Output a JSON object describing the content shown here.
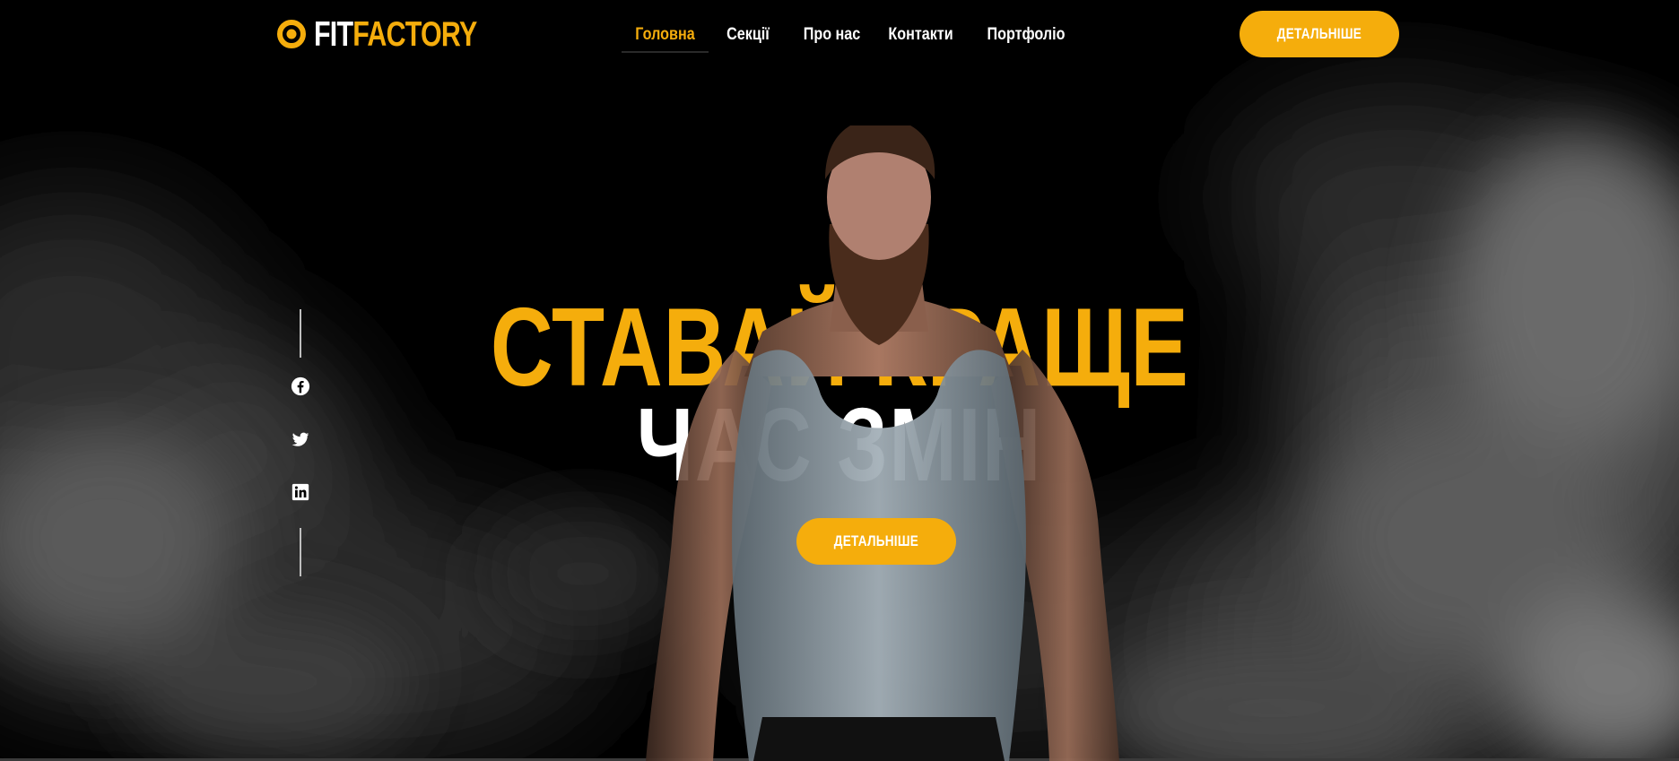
{
  "brand": {
    "name_part1": "FIT",
    "name_part2": "FACTORY",
    "accent_color": "#f5ad0c",
    "icon": "ring-logo-icon"
  },
  "nav": {
    "items": [
      {
        "label": "Головна",
        "active": true
      },
      {
        "label": "Секції",
        "active": false
      },
      {
        "label": "Про нас",
        "active": false
      },
      {
        "label": "Контакти",
        "active": false
      },
      {
        "label": "Портфоліо",
        "active": false
      }
    ]
  },
  "header": {
    "cta_label": "ДЕТАЛЬНІШЕ"
  },
  "hero": {
    "title_line1": "СТАВАЙ КРАЩЕ",
    "title_line2": "ЧАС ЗМІН",
    "cta_label": "ДЕТАЛЬНІШЕ",
    "title_line1_color": "#f5ad0c",
    "title_line2_color": "#ffffff",
    "background_color": "#000000"
  },
  "social": {
    "icons": [
      "facebook-icon",
      "twitter-icon",
      "linkedin-icon"
    ]
  }
}
